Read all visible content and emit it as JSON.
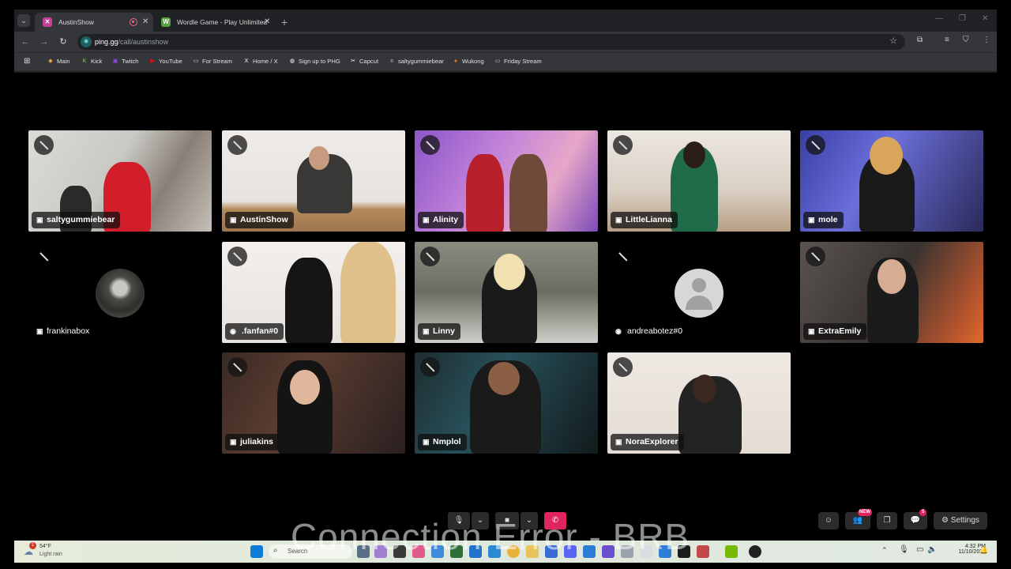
{
  "browser": {
    "tabs": [
      {
        "title": "AustinShow",
        "active": true
      },
      {
        "title": "Wordle Game - Play Unlimited",
        "active": false
      }
    ],
    "url_host": "ping.gg",
    "url_path": "/call/austinshow",
    "bookmarks": [
      "Main",
      "Kick",
      "Twitch",
      "YouTube",
      "For Stream",
      "Home / X",
      "Sign up to PHG",
      "Capcut",
      "saltygummiebear",
      "Wukong",
      "Friday Stream"
    ]
  },
  "participants": [
    {
      "name": "saltygummiebear",
      "platform": "twitch",
      "video": true
    },
    {
      "name": "AustinShow",
      "platform": "twitch",
      "video": true
    },
    {
      "name": "Alinity",
      "platform": "twitch",
      "video": true
    },
    {
      "name": "LittleLianna",
      "platform": "twitch",
      "video": true
    },
    {
      "name": "mole",
      "platform": "twitch",
      "video": true
    },
    {
      "name": "frankinabox",
      "platform": "twitch",
      "video": false
    },
    {
      "name": ".fanfan#0",
      "platform": "discord",
      "video": true
    },
    {
      "name": "Linny",
      "platform": "twitch",
      "video": true
    },
    {
      "name": "andreabotez#0",
      "platform": "discord",
      "video": false
    },
    {
      "name": "ExtraEmily",
      "platform": "twitch",
      "video": true
    },
    {
      "name": "juliakins",
      "platform": "twitch",
      "video": true
    },
    {
      "name": "Nmplol",
      "platform": "twitch",
      "video": true
    },
    {
      "name": "NoraExplorer",
      "platform": "twitch",
      "video": true
    }
  ],
  "controls": {
    "settings_label": "Settings",
    "new_badge": "NEW",
    "chat_count": "5"
  },
  "overlay_text": "Connection Error - BRB",
  "taskbar": {
    "weather_temp": "54°F",
    "weather_desc": "Light rain",
    "weather_alert": "1",
    "search_placeholder": "Search",
    "time": "4:32 PM",
    "date": "11/10/2024"
  },
  "colors": {
    "accent": "#e0245e",
    "browser_dark": "#202124",
    "toolbar": "#35363a"
  }
}
